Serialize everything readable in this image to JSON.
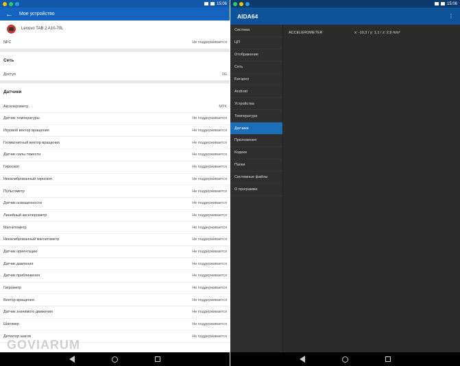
{
  "left": {
    "status_time": "15:06",
    "title": "Мое устройство",
    "device_name": "Lenovo TAB 2 A10-70L",
    "nfc": {
      "label": "NFC",
      "value": "Не поддерживается"
    },
    "net_section": "Сеть",
    "access": {
      "label": "Доступ",
      "value": "3G"
    },
    "sensors_section": "Датчики",
    "sensors": [
      {
        "label": "Акселерометр",
        "value": "MTK"
      },
      {
        "label": "Датчик температуры",
        "value": "Не поддерживается"
      },
      {
        "label": "Игровой вектор вращения",
        "value": "Не поддерживается"
      },
      {
        "label": "Геомагнитный вектор вращения",
        "value": "Не поддерживается"
      },
      {
        "label": "Датчик силы тяжести",
        "value": "Не поддерживается"
      },
      {
        "label": "Гироскоп",
        "value": "Не поддерживается"
      },
      {
        "label": "Некалиброванный гироскоп",
        "value": "Не поддерживается"
      },
      {
        "label": "Пульсометр",
        "value": "Не поддерживается"
      },
      {
        "label": "Датчик освещенности",
        "value": "Не поддерживается"
      },
      {
        "label": "Линейный акселерометр",
        "value": "Не поддерживается"
      },
      {
        "label": "Магнитометр",
        "value": "Не поддерживается"
      },
      {
        "label": "Некалиброванный магнитометр",
        "value": "Не поддерживается"
      },
      {
        "label": "Датчик ориентации",
        "value": "Не поддерживается"
      },
      {
        "label": "Датчик давления",
        "value": "Не поддерживается"
      },
      {
        "label": "Датчик приближения",
        "value": "Не поддерживается"
      },
      {
        "label": "Гигрометр",
        "value": "Не поддерживается"
      },
      {
        "label": "Вектор вращения",
        "value": "Не поддерживается"
      },
      {
        "label": "Датчик значимого движения",
        "value": "Не поддерживается"
      },
      {
        "label": "Шагомер",
        "value": "Не поддерживается"
      },
      {
        "label": "Детектор шагов",
        "value": "Не поддерживается"
      }
    ],
    "watermark": "GOVIARUM"
  },
  "right": {
    "status_time": "15:06",
    "title": "AIDA64",
    "menu": [
      "Система",
      "ЦП",
      "Отображение",
      "Сеть",
      "Батарея",
      "Android",
      "Устройства",
      "Температура",
      "Датчики",
      "Приложения",
      "Кодеки",
      "Папки",
      "Системные файлы",
      "О программе"
    ],
    "active_index": 8,
    "detail": {
      "key": "ACCELEROMETER",
      "value": "x: -10,3 / y: 1,1 / z: 2,9 m/s²"
    }
  },
  "colors": {
    "left_appbar": "#1565c0",
    "right_appbar": "#0e5299",
    "active_item": "#1a6fb8"
  }
}
